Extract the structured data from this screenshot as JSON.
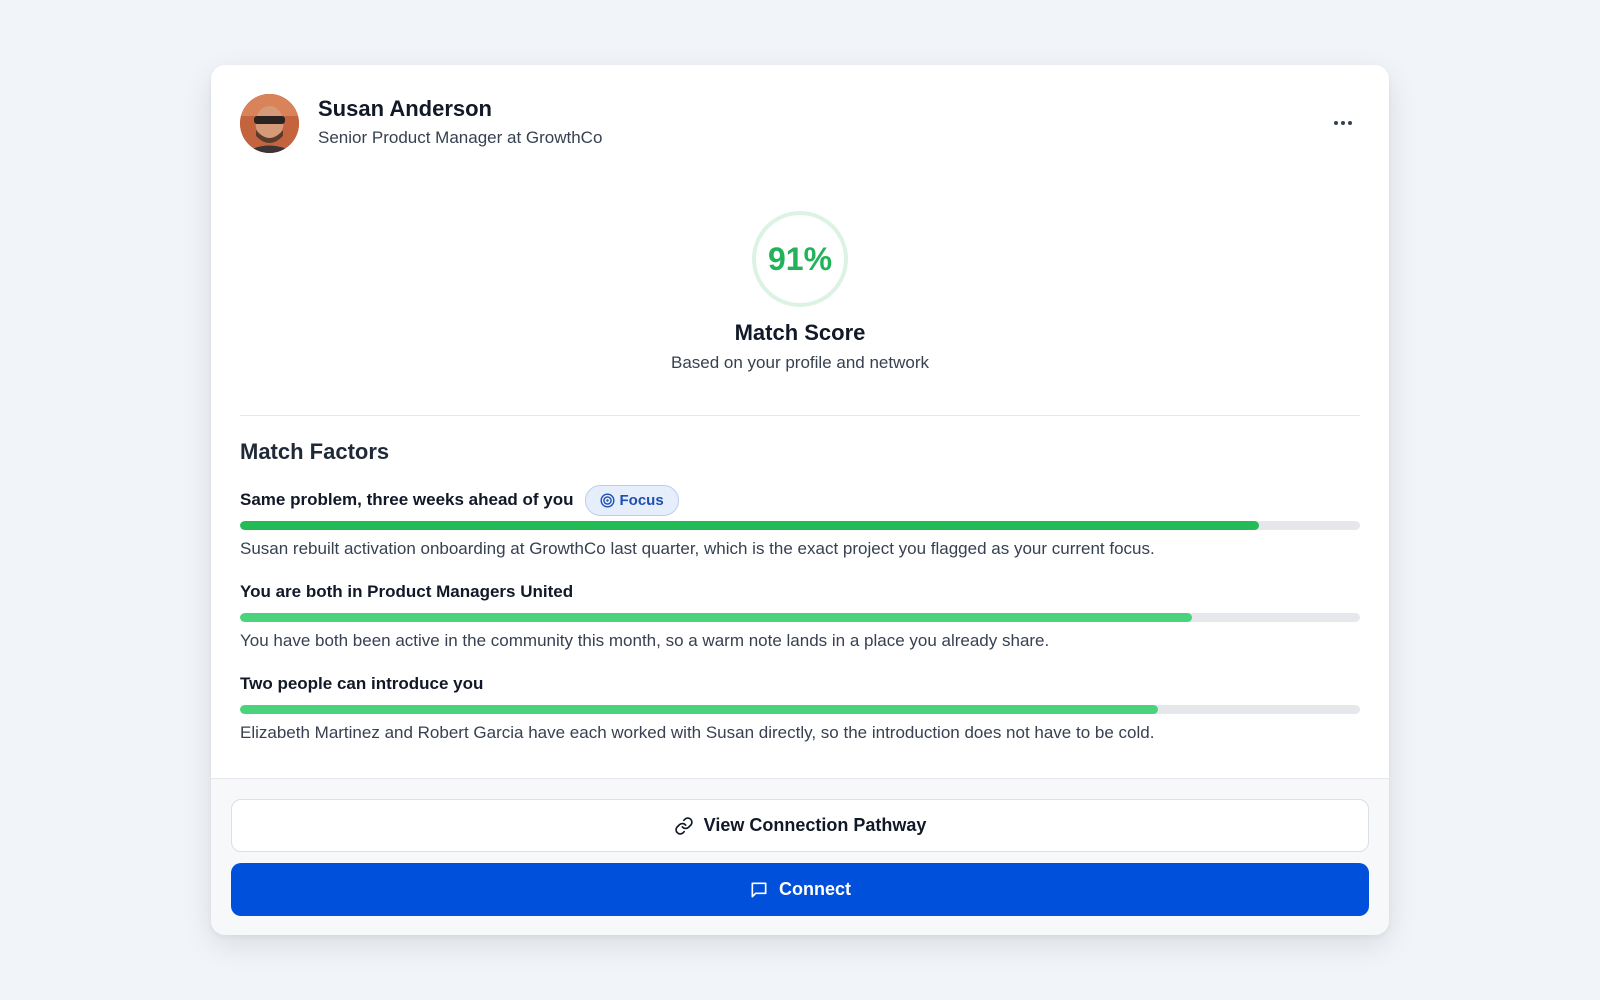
{
  "profile": {
    "name": "Susan Anderson",
    "role": "Senior Product Manager at GrowthCo",
    "avatar_icon": "person-photo-avatar",
    "more_icon": "ellipsis-icon"
  },
  "score": {
    "value": "91%",
    "value_fraction": 0.91,
    "title": "Match Score",
    "subtitle": "Based on your profile and network",
    "color": "#22b35a"
  },
  "factors_title": "Match Factors",
  "factors": [
    {
      "label": "Same problem, three weeks ahead of you",
      "badge": "Focus",
      "badge_icon": "target-icon",
      "strength": 0.91,
      "color": "#22bb55",
      "description": "Susan rebuilt activation onboarding at GrowthCo last quarter, which is the exact project you flagged as your current focus."
    },
    {
      "label": "You are both in Product Managers United",
      "strength": 0.85,
      "color": "#4ad37d",
      "description": "You have both been active in the community this month, so a warm note lands in a place you already share."
    },
    {
      "label": "Two people can introduce you",
      "strength": 0.82,
      "color": "#4ad37d",
      "description": "Elizabeth Martinez and Robert Garcia have each worked with Susan directly, so the introduction does not have to be cold."
    }
  ],
  "actions": {
    "pathway_label": "View Connection Pathway",
    "pathway_icon": "link-icon",
    "connect_label": "Connect",
    "connect_icon": "message-icon",
    "primary_color": "#0050dc"
  }
}
